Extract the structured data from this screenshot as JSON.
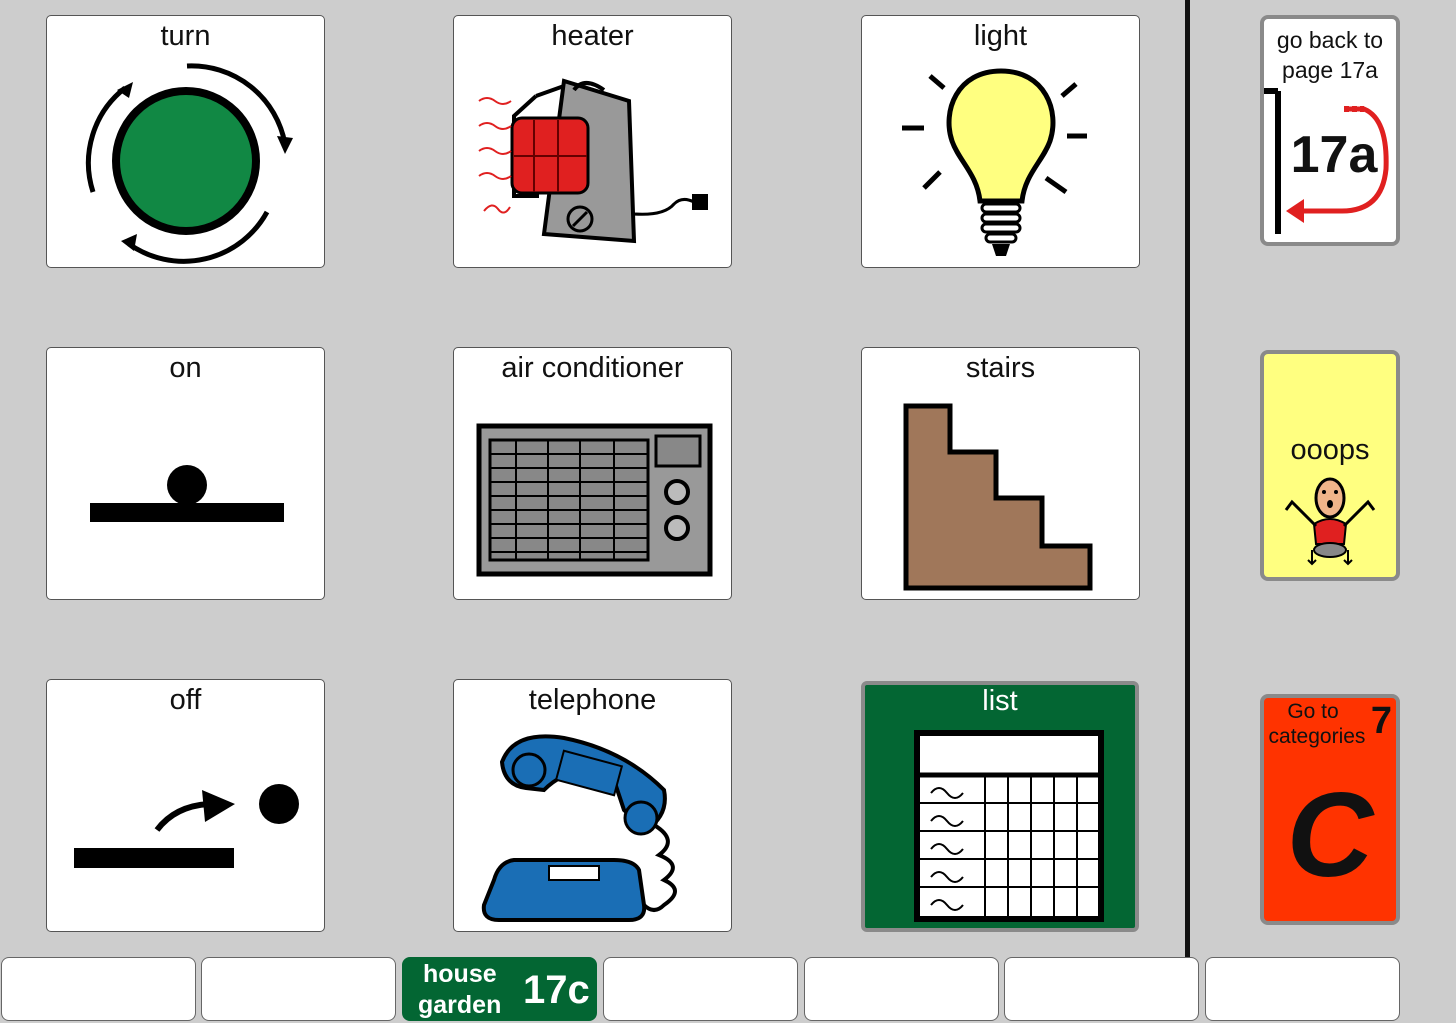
{
  "grid": {
    "turn": "turn",
    "heater": "heater",
    "light": "light",
    "on": "on",
    "air_conditioner": "air conditioner",
    "stairs": "stairs",
    "off": "off",
    "telephone": "telephone",
    "list": "list"
  },
  "sidebar": {
    "go_back_line1": "go back to",
    "go_back_line2": "page 17a",
    "go_back_page": "17a",
    "ooops": "ooops",
    "categories_line1": "Go to",
    "categories_line2": "categories",
    "categories_number": "7",
    "categories_letter": "C"
  },
  "bottom_tabs": {
    "active_line1": "house",
    "active_line2": "garden",
    "active_page": "17c"
  },
  "colors": {
    "background": "#cdcdcd",
    "active_green": "#036633",
    "oops_yellow": "#ffff80",
    "categories_orange": "#ff3300"
  }
}
